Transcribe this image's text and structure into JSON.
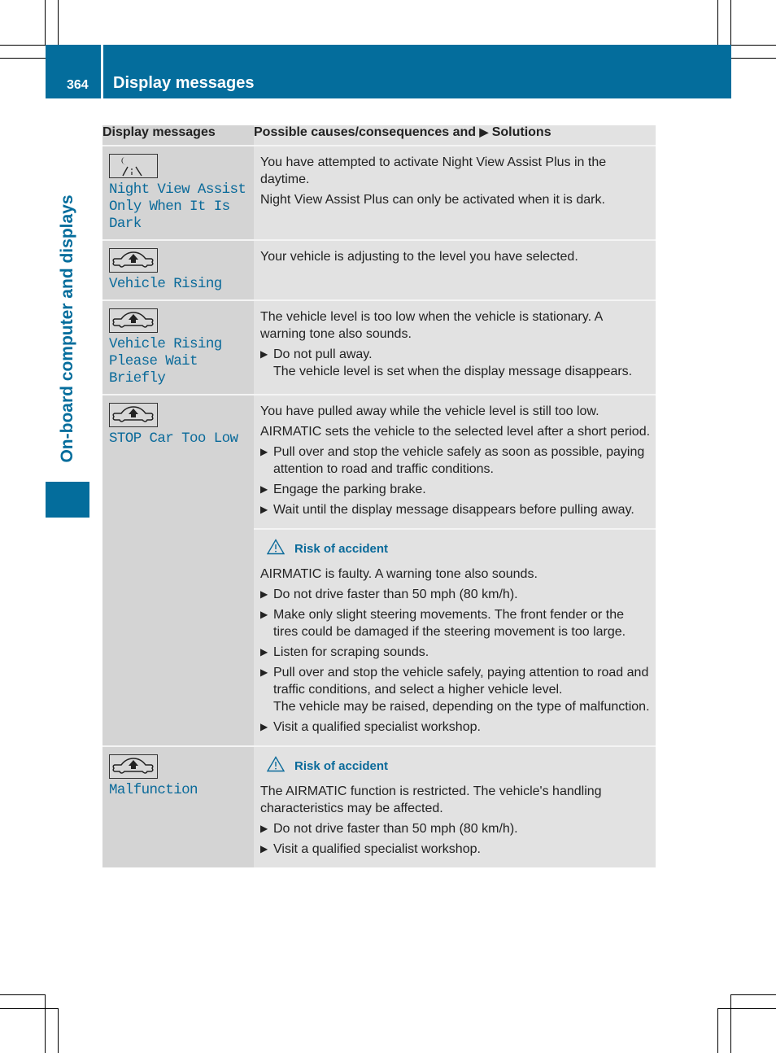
{
  "page": {
    "number": "364",
    "title": "Display messages",
    "side_label": "On-board computer and displays",
    "accent_color": "#046d9c"
  },
  "table": {
    "headers": {
      "col1": "Display messages",
      "col2_prefix": "Possible causes/consequences and",
      "col2_arrow": "▶",
      "col2_suffix": "Solutions"
    },
    "bullet_glyph": "▶",
    "rows": [
      {
        "icon": "night-view-icon",
        "message": "Night View Assist\nOnly When It Is\nDark",
        "paragraphs": [
          "You have attempted to activate Night View Assist Plus in the daytime.",
          "Night View Assist Plus can only be activated when it is dark."
        ]
      },
      {
        "icon": "vehicle-level-icon",
        "message": "Vehicle Rising",
        "paragraphs": [
          "Your vehicle is adjusting to the level you have selected."
        ]
      },
      {
        "icon": "vehicle-level-icon",
        "message": "Vehicle Rising\nPlease Wait Briefly",
        "paragraphs": [
          "The vehicle level is too low when the vehicle is stationary. A warning tone also sounds."
        ],
        "bullets": [
          {
            "text": "Do not pull away.",
            "note": "The vehicle level is set when the display message disappears."
          }
        ]
      },
      {
        "icon": "vehicle-level-icon",
        "message": "STOP Car Too Low",
        "paragraphs": [
          "You have pulled away while the vehicle level is still too low.",
          "AIRMATIC sets the vehicle to the selected level after a short period."
        ],
        "bullets": [
          {
            "text": "Pull over and stop the vehicle safely as soon as possible, paying attention to road and traffic conditions."
          },
          {
            "text": "Engage the parking brake."
          },
          {
            "text": "Wait until the display message disappears before pulling away."
          }
        ],
        "warning": {
          "label": "Risk of accident",
          "paragraphs": [
            "AIRMATIC is faulty. A warning tone also sounds."
          ],
          "bullets": [
            {
              "text": "Do not drive faster than 50 mph (80 km/h)."
            },
            {
              "text": "Make only slight steering movements. The front fender or the tires could be damaged if the steering movement is too large."
            },
            {
              "text": "Listen for scraping sounds."
            },
            {
              "text": "Pull over and stop the vehicle safely, paying attention to road and traffic conditions, and select a higher vehicle level.",
              "note": "The vehicle may be raised, depending on the type of malfunction."
            },
            {
              "text": "Visit a qualified specialist workshop."
            }
          ]
        }
      },
      {
        "icon": "vehicle-level-icon",
        "message": "Malfunction",
        "warning_label": "Risk of accident",
        "paragraphs": [
          "The AIRMATIC function is restricted. The vehicle's handling characteristics may be affected."
        ],
        "bullets": [
          {
            "text": "Do not drive faster than 50 mph (80 km/h)."
          },
          {
            "text": "Visit a qualified specialist workshop."
          }
        ]
      }
    ]
  }
}
